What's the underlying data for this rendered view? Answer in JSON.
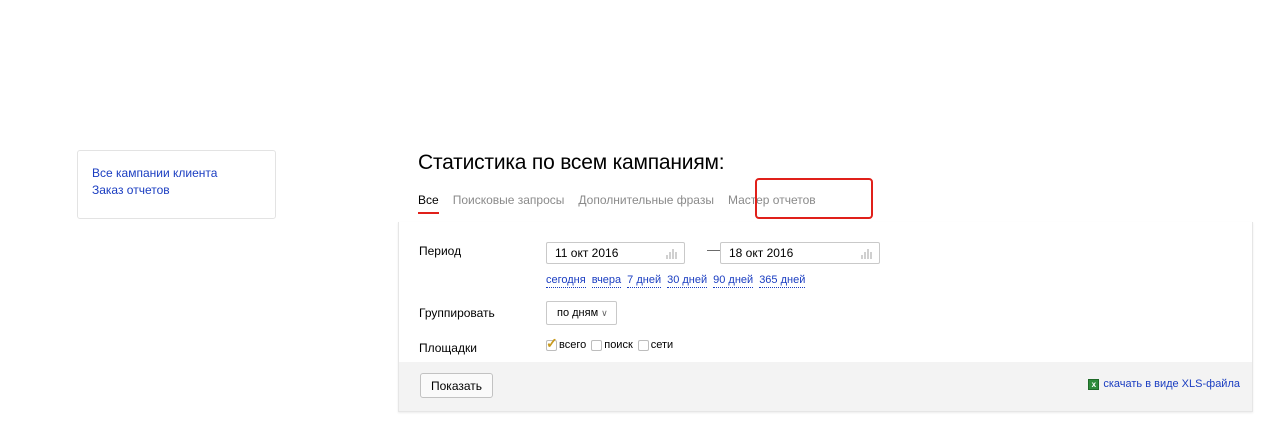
{
  "sidebar": {
    "links": [
      {
        "label": "Все кампании клиента"
      },
      {
        "label": "Заказ отчетов"
      }
    ]
  },
  "title": "Статистика по всем кампаниям:",
  "tabs": [
    {
      "label": "Все",
      "active": true
    },
    {
      "label": "Поисковые запросы",
      "active": false
    },
    {
      "label": "Дополнительные фразы",
      "active": false
    },
    {
      "label": "Мастер отчетов",
      "active": false,
      "highlighted": true
    }
  ],
  "form": {
    "period_label": "Период",
    "date_from": "11 окт 2016",
    "date_to": "18 окт 2016",
    "date_separator": "—",
    "quick_ranges": [
      "сегодня",
      "вчера",
      "7 дней",
      "30 дней",
      "90 дней",
      "365 дней"
    ],
    "group_label": "Группировать",
    "group_value": "по дням",
    "platforms_label": "Площадки",
    "platforms": [
      {
        "label": "всего",
        "checked": true
      },
      {
        "label": "поиск",
        "checked": false
      },
      {
        "label": "сети",
        "checked": false
      }
    ],
    "submit_label": "Показать",
    "download_label": "скачать в виде XLS-файла"
  },
  "colors": {
    "link": "#1a3dc1",
    "accent_red": "#e0201a",
    "footer_bg": "#f3f3f3"
  },
  "icons": {
    "calendar": "calendar-icon",
    "chevron": "chevron-down-icon",
    "excel": "excel-icon"
  }
}
